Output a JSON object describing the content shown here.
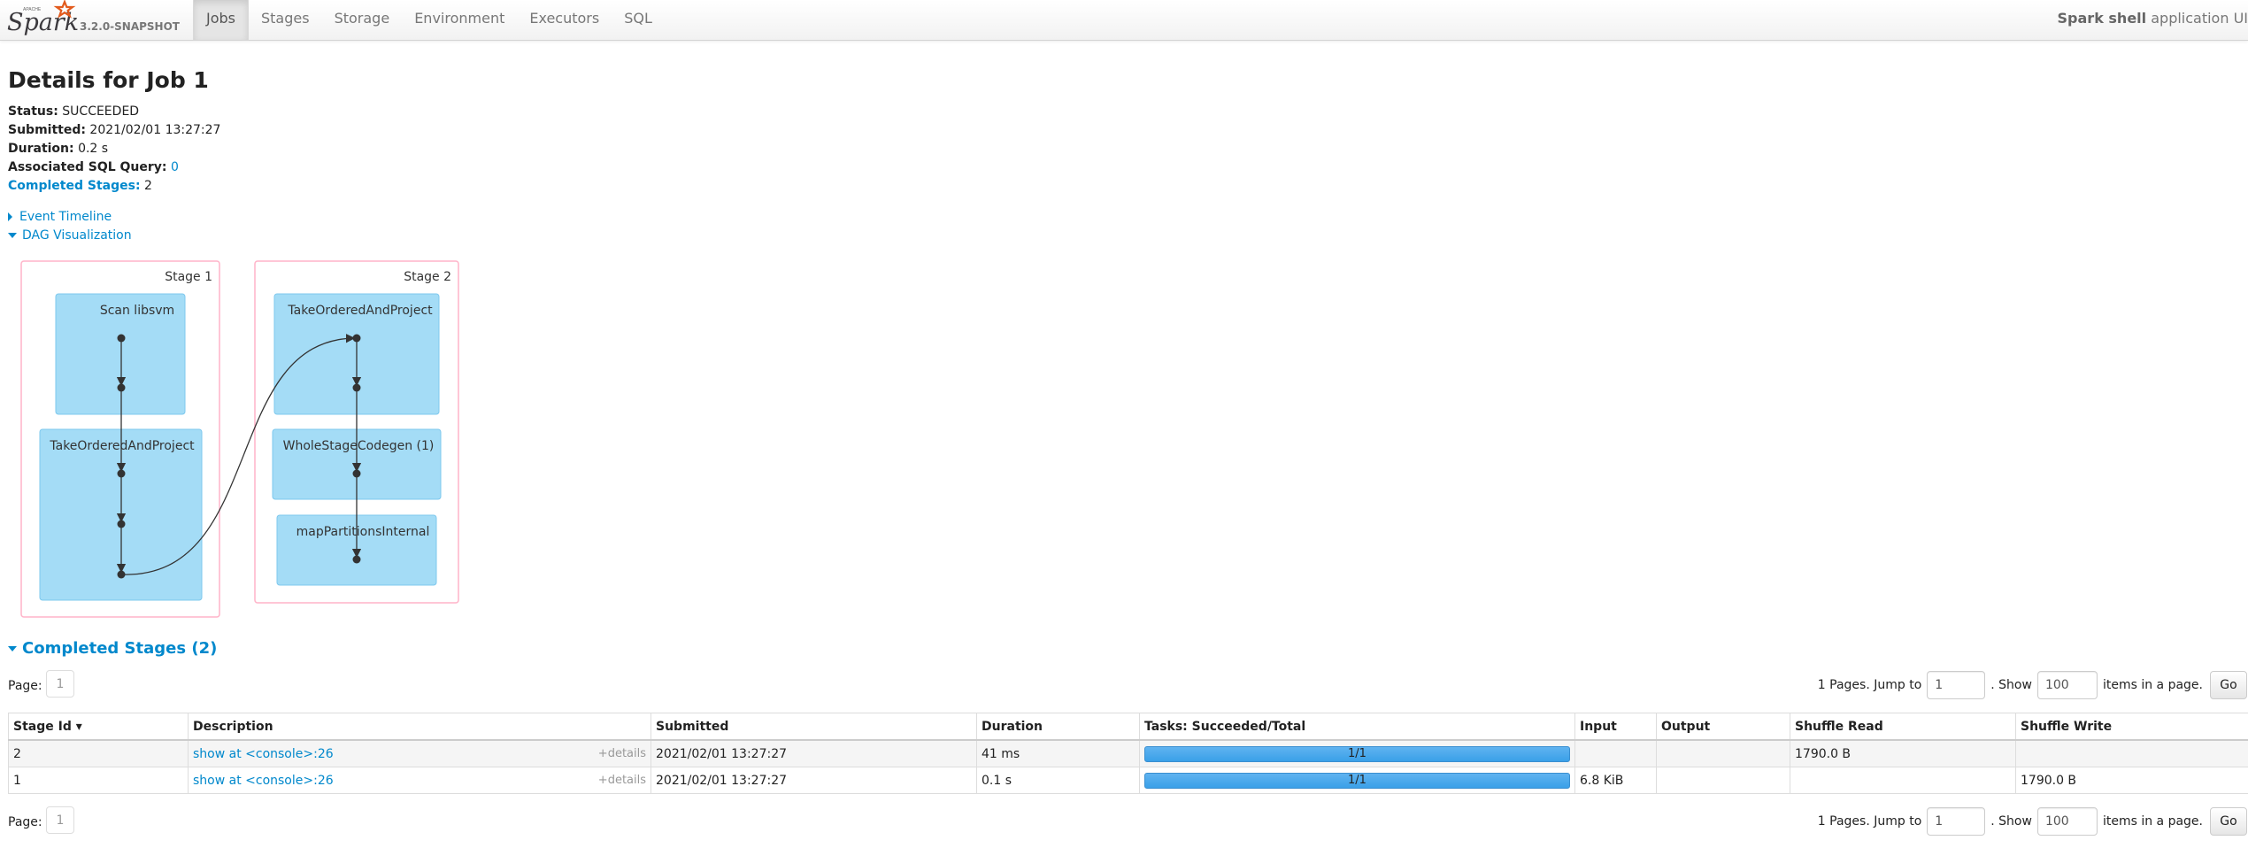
{
  "navbar": {
    "brand_apache": "APACHE",
    "brand_name": "Spark",
    "version": "3.2.0-SNAPSHOT",
    "tabs": [
      {
        "label": "Jobs",
        "active": true
      },
      {
        "label": "Stages",
        "active": false
      },
      {
        "label": "Storage",
        "active": false
      },
      {
        "label": "Environment",
        "active": false
      },
      {
        "label": "Executors",
        "active": false
      },
      {
        "label": "SQL",
        "active": false
      }
    ],
    "app_name": "Spark shell",
    "app_suffix": " application UI"
  },
  "job": {
    "title": "Details for Job 1",
    "status_label": "Status:",
    "status": "SUCCEEDED",
    "submitted_label": "Submitted:",
    "submitted": "2021/02/01 13:27:27",
    "duration_label": "Duration:",
    "duration": "0.2 s",
    "sql_label": "Associated SQL Query:",
    "sql_query": "0",
    "completed_label": "Completed Stages:",
    "completed_count": "2"
  },
  "toggles": {
    "event_timeline": "Event Timeline",
    "dag_visualization": "DAG Visualization"
  },
  "dag": {
    "stage1_label": "Stage 1",
    "stage2_label": "Stage 2",
    "nodes": {
      "scan": "Scan libsvm",
      "take1": "TakeOrderedAndProject",
      "take2": "TakeOrderedAndProject",
      "wsc": "WholeStageCodegen (1)",
      "map": "mapPartitionsInternal"
    },
    "colors": {
      "stage_border": "#ffb3c8",
      "cluster_fill": "#a4dcf6",
      "cluster_border": "#7ec8ee",
      "node": "#333333"
    }
  },
  "stages_section": {
    "title": "Completed Stages (2)",
    "page_label": "Page:",
    "current_page": "1",
    "pages_text": "1 Pages. Jump to",
    "jump_value": "1",
    "show_text": ". Show",
    "show_value": "100",
    "items_text": "items in a page.",
    "go_label": "Go",
    "columns": [
      "Stage Id ▾",
      "Description",
      "Submitted",
      "Duration",
      "Tasks: Succeeded/Total",
      "Input",
      "Output",
      "Shuffle Read",
      "Shuffle Write"
    ],
    "details_label": "+details",
    "rows": [
      {
        "id": "2",
        "description": "show at <console>:26",
        "submitted": "2021/02/01 13:27:27",
        "duration": "41 ms",
        "tasks": "1/1",
        "progress": 1.0,
        "input": "",
        "output": "",
        "shuffle_read": "1790.0 B",
        "shuffle_write": ""
      },
      {
        "id": "1",
        "description": "show at <console>:26",
        "submitted": "2021/02/01 13:27:27",
        "duration": "0.1 s",
        "tasks": "1/1",
        "progress": 1.0,
        "input": "6.8 KiB",
        "output": "",
        "shuffle_read": "",
        "shuffle_write": "1790.0 B"
      }
    ]
  }
}
